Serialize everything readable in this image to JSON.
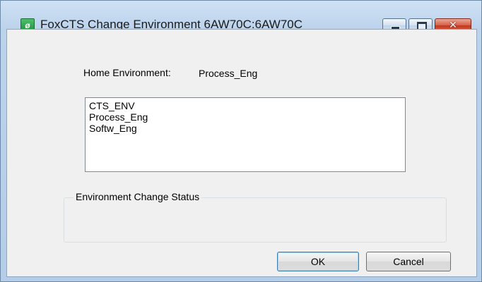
{
  "window": {
    "title": "FoxCTS Change Environment 6AW70C:6AW70C",
    "app_icon": "foxcts-leaf-icon",
    "controls": {
      "minimize": "minimize-icon",
      "maximize": "maximize-icon",
      "close": "✕"
    }
  },
  "home_environment": {
    "label": "Home Environment:",
    "value": "Process_Eng"
  },
  "environment_list": {
    "items": [
      "CTS_ENV",
      "Process_Eng",
      "Softw_Eng"
    ]
  },
  "status_group": {
    "label": "Environment Change Status",
    "text": ""
  },
  "buttons": {
    "ok": "OK",
    "cancel": "Cancel"
  },
  "colors": {
    "title_bar": "#bcd3ec",
    "close_button": "#c2381f",
    "dialog_background": "#f0f0f0"
  }
}
